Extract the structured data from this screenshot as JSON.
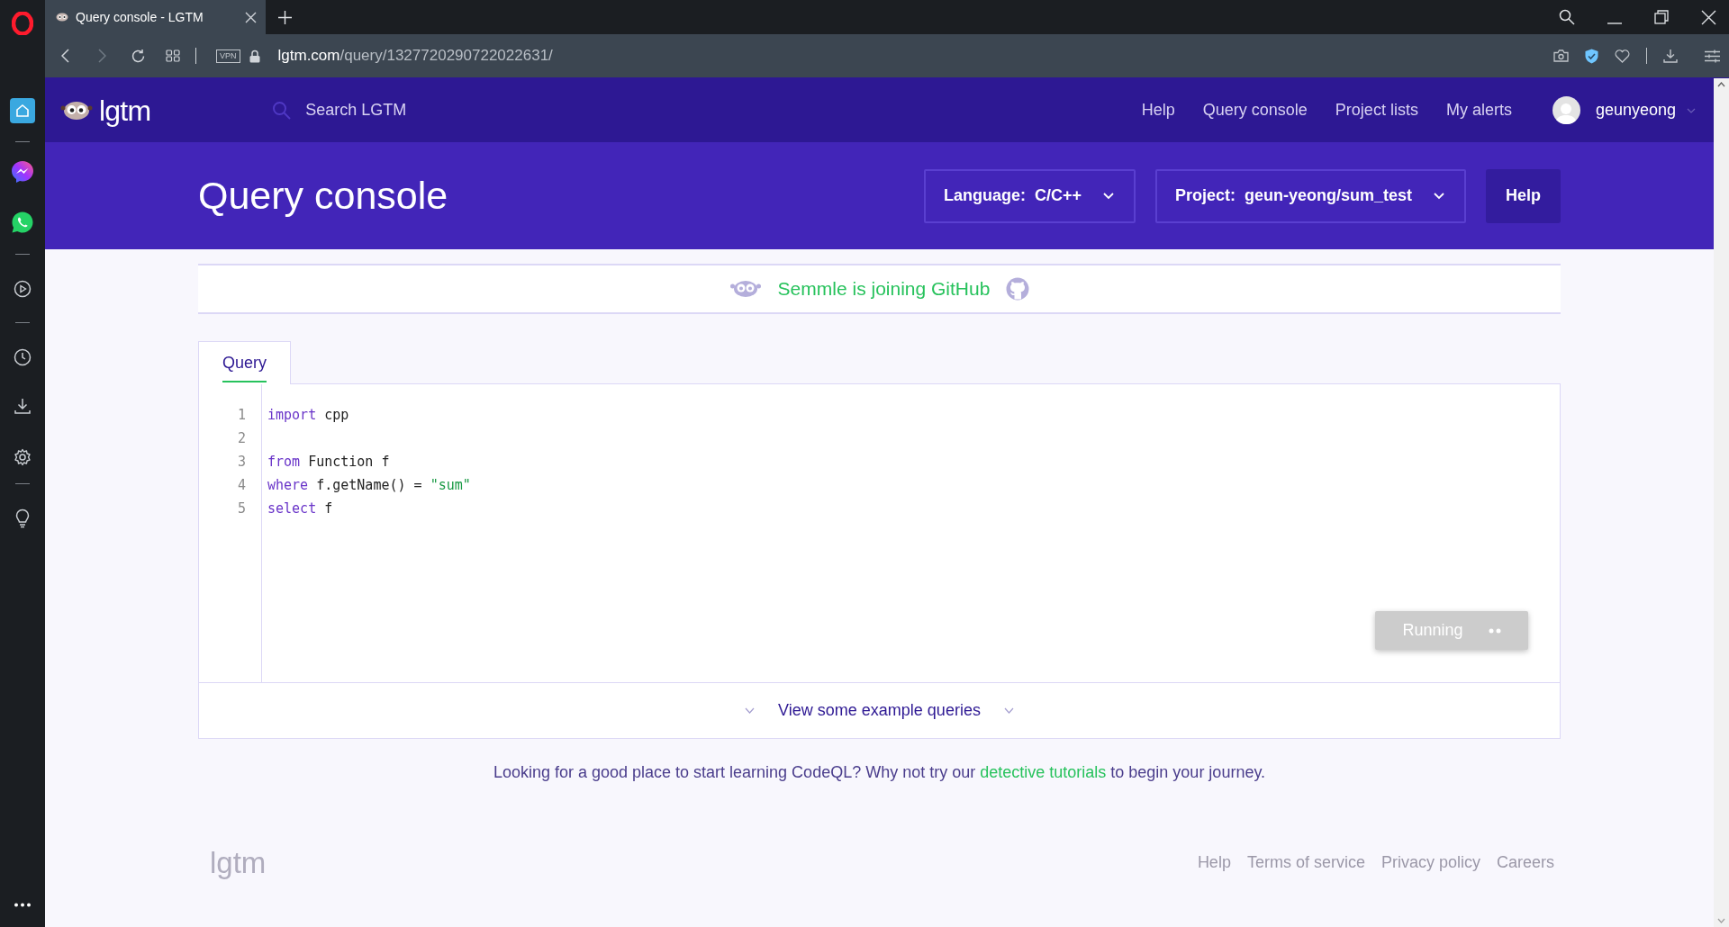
{
  "browser": {
    "tab_title": "Query console - LGTM",
    "url_domain": "lgtm.com",
    "url_path": "/query/1327720290722022631/",
    "vpn_label": "VPN"
  },
  "site_nav": {
    "logo": "lgtm",
    "search_placeholder": "Search LGTM",
    "links": [
      "Help",
      "Query console",
      "Project lists",
      "My alerts"
    ],
    "user": "geunyeong"
  },
  "header": {
    "title": "Query console",
    "dropdowns": [
      {
        "label": "Language:",
        "value": "C/C++"
      },
      {
        "label": "Project:",
        "value": "geun-yeong/sum_test"
      }
    ],
    "help_button": "Help"
  },
  "banner": {
    "text": "Semmle is joining GitHub"
  },
  "editor_tabs": [
    {
      "label": "Query",
      "selected": true
    }
  ],
  "code": [
    {
      "number": "1",
      "tokens": [
        {
          "text": "import",
          "kind": "keyword"
        },
        {
          "text": " cpp",
          "kind": "plain"
        }
      ]
    },
    {
      "number": "2"
    },
    {
      "number": "3",
      "tokens": [
        {
          "text": "from",
          "kind": "keyword"
        },
        {
          "text": " Function f",
          "kind": "plain"
        }
      ]
    },
    {
      "number": "4",
      "tokens": [
        {
          "text": "where",
          "kind": "keyword"
        },
        {
          "text": " f.getName() = ",
          "kind": "plain"
        },
        {
          "text": "\"sum\"",
          "kind": "string"
        }
      ]
    },
    {
      "number": "5",
      "tokens": [
        {
          "text": "select",
          "kind": "keyword"
        },
        {
          "text": " f",
          "kind": "plain"
        }
      ]
    }
  ],
  "run_button": {
    "label": "Running",
    "disabled": true
  },
  "examples_link": "View some example queries",
  "learning": {
    "before": "Looking for a good place to start learning CodeQL? Why not try our ",
    "link": "detective tutorials",
    "after": " to begin your journey."
  },
  "footer": {
    "logo": "lgtm",
    "links": [
      "Help",
      "Terms of service",
      "Privacy policy",
      "Careers"
    ]
  }
}
